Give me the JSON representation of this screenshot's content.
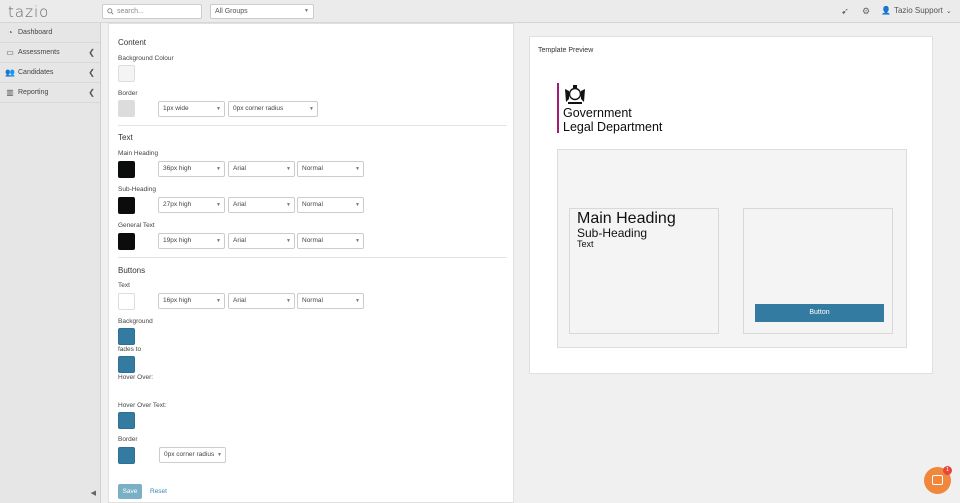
{
  "app": {
    "logo": "tazio"
  },
  "topbar": {
    "search_placeholder": "search...",
    "group_select": "All Groups",
    "user_name": "Tazio Support"
  },
  "sidebar": {
    "items": [
      {
        "label": "Dashboard",
        "icon": "dashboard-icon"
      },
      {
        "label": "Assessments",
        "icon": "laptop-icon"
      },
      {
        "label": "Candidates",
        "icon": "users-icon"
      },
      {
        "label": "Reporting",
        "icon": "bar-chart-icon"
      }
    ]
  },
  "form": {
    "content": {
      "title": "Content",
      "background_label": "Background Colour",
      "border_label": "Border",
      "border_width": "1px wide",
      "border_radius": "0px corner radius"
    },
    "text": {
      "title": "Text",
      "main_heading": {
        "label": "Main Heading",
        "size": "36px high",
        "font": "Arial",
        "weight": "Normal"
      },
      "sub_heading": {
        "label": "Sub-Heading",
        "size": "27px high",
        "font": "Arial",
        "weight": "Normal"
      },
      "general_text": {
        "label": "General Text",
        "size": "19px high",
        "font": "Arial",
        "weight": "Normal"
      }
    },
    "buttons": {
      "title": "Buttons",
      "text": {
        "label": "Text",
        "size": "16px high",
        "font": "Arial",
        "weight": "Normal"
      },
      "background_label": "Background",
      "fades_to_label": "fades to",
      "hover_over_label": "Hover Over:",
      "hover_over_text_label": "Hover Over Text:",
      "border_label": "Border",
      "border_radius": "0px corner radius"
    },
    "save_label": "Save",
    "reset_label": "Reset"
  },
  "preview": {
    "title": "Template Preview",
    "org_line1": "Government",
    "org_line2": "Legal Department",
    "main_heading": "Main Heading",
    "sub_heading": "Sub-Heading",
    "text": "Text",
    "button_label": "Button"
  },
  "chat": {
    "badge": "1"
  },
  "colors": {
    "button_blue": "#347ba2",
    "brand_purple": "#a01c77",
    "chat_orange": "#f1873c"
  }
}
